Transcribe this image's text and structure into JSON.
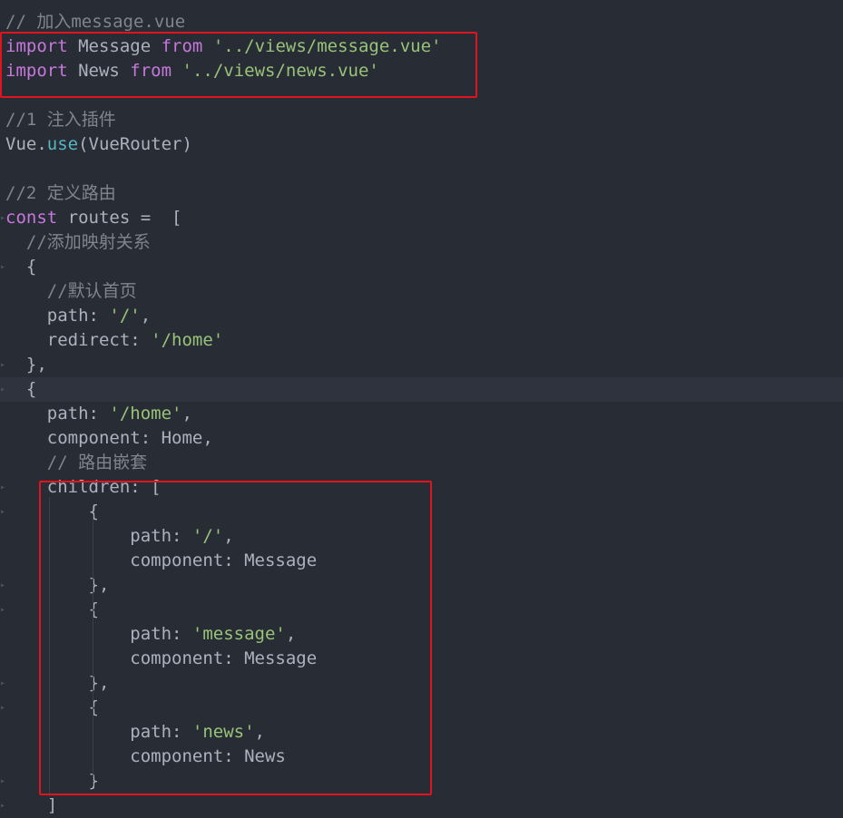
{
  "colors": {
    "background": "#282c34",
    "keyword": "#c678dd",
    "string": "#98c379",
    "comment": "#7f848e",
    "function": "#56b6c2",
    "text": "#abb2bf",
    "annotation_box": "#e0141f"
  },
  "code_lines": [
    {
      "tokens": [
        {
          "text": "// 加入message.vue",
          "type": "comment"
        }
      ]
    },
    {
      "tokens": [
        {
          "text": "import",
          "type": "keyword"
        },
        {
          "text": " Message ",
          "type": "text"
        },
        {
          "text": "from",
          "type": "keyword"
        },
        {
          "text": " ",
          "type": "text"
        },
        {
          "text": "'../views/message.vue'",
          "type": "string"
        }
      ]
    },
    {
      "tokens": [
        {
          "text": "import",
          "type": "keyword"
        },
        {
          "text": " News ",
          "type": "text"
        },
        {
          "text": "from",
          "type": "keyword"
        },
        {
          "text": " ",
          "type": "text"
        },
        {
          "text": "'../views/news.vue'",
          "type": "string"
        }
      ]
    },
    {
      "tokens": []
    },
    {
      "tokens": [
        {
          "text": "//1 注入插件",
          "type": "comment"
        }
      ]
    },
    {
      "tokens": [
        {
          "text": "Vue.",
          "type": "text"
        },
        {
          "text": "use",
          "type": "function"
        },
        {
          "text": "(VueRouter)",
          "type": "text"
        }
      ]
    },
    {
      "tokens": []
    },
    {
      "tokens": [
        {
          "text": "//2 定义路由",
          "type": "comment"
        }
      ]
    },
    {
      "tokens": [
        {
          "text": "const",
          "type": "keyword"
        },
        {
          "text": " routes =  [",
          "type": "text"
        }
      ]
    },
    {
      "tokens": [
        {
          "text": "  //添加映射关系",
          "type": "comment"
        }
      ]
    },
    {
      "tokens": [
        {
          "text": "  {",
          "type": "text"
        }
      ]
    },
    {
      "tokens": [
        {
          "text": "    //默认首页",
          "type": "comment"
        }
      ]
    },
    {
      "tokens": [
        {
          "text": "    path: ",
          "type": "text"
        },
        {
          "text": "'/'",
          "type": "string"
        },
        {
          "text": ",",
          "type": "text"
        }
      ]
    },
    {
      "tokens": [
        {
          "text": "    redirect: ",
          "type": "text"
        },
        {
          "text": "'/home'",
          "type": "string"
        }
      ]
    },
    {
      "tokens": [
        {
          "text": "  },",
          "type": "text"
        }
      ]
    },
    {
      "tokens": [
        {
          "text": "  {",
          "type": "text"
        }
      ],
      "highlight": true
    },
    {
      "tokens": [
        {
          "text": "    path: ",
          "type": "text"
        },
        {
          "text": "'/home'",
          "type": "string"
        },
        {
          "text": ",",
          "type": "text"
        }
      ]
    },
    {
      "tokens": [
        {
          "text": "    component: Home,",
          "type": "text"
        }
      ]
    },
    {
      "tokens": [
        {
          "text": "    // 路由嵌套",
          "type": "comment"
        }
      ]
    },
    {
      "tokens": [
        {
          "text": "    children: [",
          "type": "text"
        }
      ]
    },
    {
      "tokens": [
        {
          "text": "        {",
          "type": "text"
        }
      ]
    },
    {
      "tokens": [
        {
          "text": "            path: ",
          "type": "text"
        },
        {
          "text": "'/'",
          "type": "string"
        },
        {
          "text": ",",
          "type": "text"
        }
      ]
    },
    {
      "tokens": [
        {
          "text": "            component: Message",
          "type": "text"
        }
      ]
    },
    {
      "tokens": [
        {
          "text": "        },",
          "type": "text"
        }
      ]
    },
    {
      "tokens": [
        {
          "text": "        {",
          "type": "text"
        }
      ]
    },
    {
      "tokens": [
        {
          "text": "            path: ",
          "type": "text"
        },
        {
          "text": "'message'",
          "type": "string"
        },
        {
          "text": ",",
          "type": "text"
        }
      ]
    },
    {
      "tokens": [
        {
          "text": "            component: Message",
          "type": "text"
        }
      ]
    },
    {
      "tokens": [
        {
          "text": "        },",
          "type": "text"
        }
      ]
    },
    {
      "tokens": [
        {
          "text": "        {",
          "type": "text"
        }
      ]
    },
    {
      "tokens": [
        {
          "text": "            path: ",
          "type": "text"
        },
        {
          "text": "'news'",
          "type": "string"
        },
        {
          "text": ",",
          "type": "text"
        }
      ]
    },
    {
      "tokens": [
        {
          "text": "            component: News",
          "type": "text"
        }
      ]
    },
    {
      "tokens": [
        {
          "text": "        }",
          "type": "text"
        }
      ]
    },
    {
      "tokens": [
        {
          "text": "    ]",
          "type": "text"
        }
      ]
    }
  ]
}
